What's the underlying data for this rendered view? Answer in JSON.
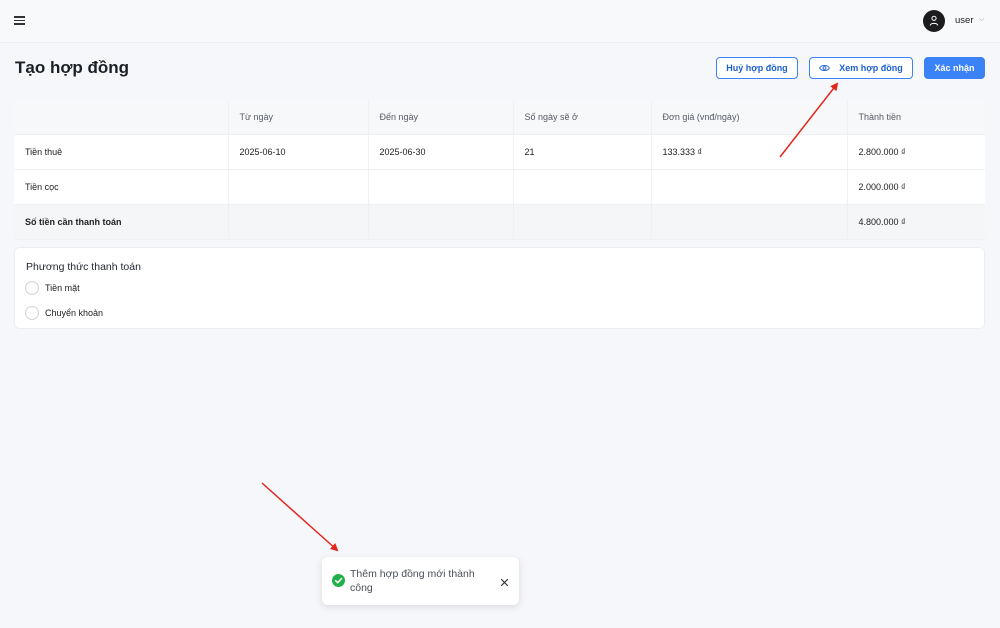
{
  "header": {
    "username": "user",
    "menu_icon": "hamburger-icon",
    "avatar_icon": "user-icon"
  },
  "page": {
    "title": "Tạo hợp đồng"
  },
  "actions": {
    "cancel_label": "Huỷ hợp đồng",
    "view_label": "Xem hợp đồng",
    "confirm_label": "Xác nhận",
    "view_icon": "eye-icon"
  },
  "table": {
    "headers": [
      "",
      "Từ ngày",
      "Đến ngày",
      "Số ngày sẽ ở",
      "Đơn giá (vnđ/ngày)",
      "Thành tiền"
    ],
    "rows": [
      [
        "Tiền thuê",
        "2025-06-10",
        "2025-06-30",
        "21",
        "133.333 ₫",
        "2.800.000 ₫"
      ],
      [
        "Tiền cọc",
        "",
        "",
        "",
        "",
        "2.000.000 ₫"
      ],
      [
        "Số tiền cần thanh toán",
        "",
        "",
        "",
        "",
        "4.800.000 ₫"
      ]
    ]
  },
  "payment": {
    "title": "Phương thức thanh toán",
    "options": [
      "Tiền mặt",
      "Chuyển khoản"
    ]
  },
  "toast": {
    "message": "Thêm hợp đồng mới thành công",
    "status_icon": "check-circle-icon",
    "close_icon": "close-icon"
  },
  "colors": {
    "primary": "#3b82f6",
    "success": "#22b04b",
    "annotation_arrow": "#e3261c"
  }
}
